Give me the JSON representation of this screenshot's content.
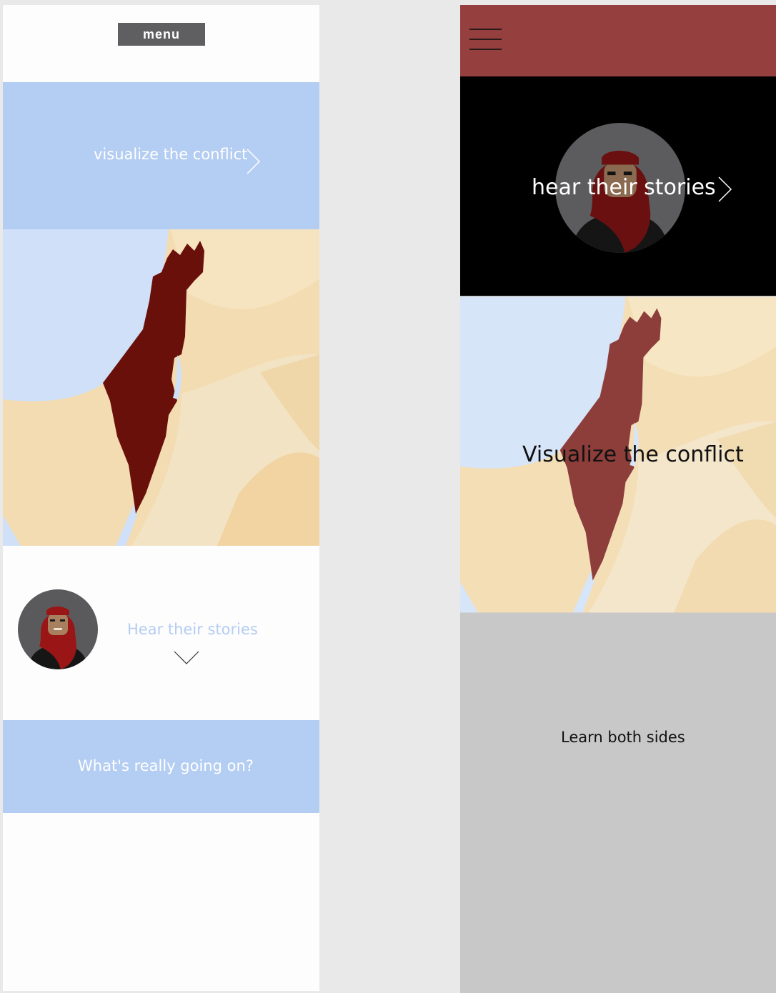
{
  "mobile_a": {
    "menu_label": "menu",
    "visualize_label": "visualize the conflict",
    "stories_label": "Hear their stories",
    "question_label": "What's really going on?"
  },
  "mobile_b": {
    "stories_label": "hear their stories",
    "visualize_label": "Visualize the conflict",
    "learn_label": "Learn both sides"
  },
  "colors": {
    "accent_blue": "#b4cdf2",
    "header_red": "#953f3f",
    "map_red_dark": "#6a100a",
    "map_red_muted": "#8d3e3b",
    "sea": "#cfe0f8",
    "land": "#f3ddb5",
    "gray_block": "#c8c8c8"
  },
  "icons": [
    "chevron-right-icon",
    "chevron-down-icon",
    "hamburger-menu-icon",
    "avatar-woman-hijab"
  ]
}
